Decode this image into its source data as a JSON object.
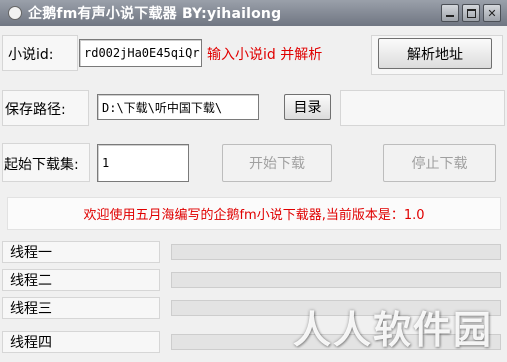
{
  "window": {
    "title": "企鹅fm有声小说下载器  BY:yihailong",
    "icon": "app-icon"
  },
  "novel": {
    "label": "小说id:",
    "value": "rd002jHa0E45qiQr",
    "hint": "输入小说id 并解析",
    "parse_button": "解析地址"
  },
  "save": {
    "label": "保存路径:",
    "value": "D:\\下载\\听中国下载\\",
    "dir_button": "目录"
  },
  "download": {
    "label": "起始下载集:",
    "value": "1",
    "start_button": "开始下载",
    "stop_button": "停止下载"
  },
  "banner": {
    "text": "欢迎使用五月海编写的企鹅fm小说下载器,当前版本是：1.0"
  },
  "threads": [
    {
      "label": "线程一",
      "progress": 0
    },
    {
      "label": "线程二",
      "progress": 0
    },
    {
      "label": "线程三",
      "progress": 0
    },
    {
      "label": "线程四",
      "progress": 0
    }
  ],
  "watermark": {
    "text": "人人软件园"
  },
  "colors": {
    "hint_red": "#e00000",
    "progress_fill": "#3cb043"
  }
}
